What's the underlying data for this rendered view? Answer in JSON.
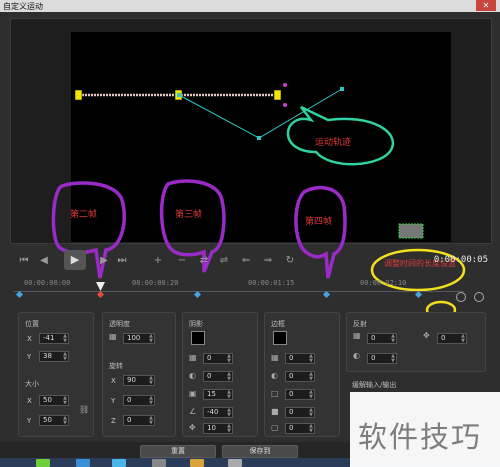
{
  "window": {
    "title": "自定义运动",
    "close_glyph": "✕"
  },
  "annotations": {
    "motion_path": "运动轨迹",
    "frame2": "第二帧",
    "frame3": "第三帧",
    "frame4": "第四帧",
    "timecode_note": "调整时间的长度设置"
  },
  "playback": {
    "timecode": "0:00:00:05"
  },
  "ruler": {
    "labels": [
      "00:00:00:00",
      "00:00:00:20",
      "00:00:01:15",
      "00:00:02:10"
    ]
  },
  "position": {
    "label": "位置",
    "x_label": "X",
    "x": "-41",
    "y_label": "Y",
    "y": "38"
  },
  "size": {
    "label": "大小",
    "x_label": "X",
    "x": "50",
    "y_label": "Y",
    "y": "50"
  },
  "opacity": {
    "label": "透明度",
    "value": "100"
  },
  "rotation": {
    "label": "旋转",
    "x_label": "X",
    "x": "90",
    "y_label": "Y",
    "y": "0",
    "z_label": "Z",
    "z": "0"
  },
  "shadow": {
    "label": "阴影",
    "v1": "0",
    "v2": "0",
    "v3": "15",
    "v4": "-40",
    "v5": "10"
  },
  "border": {
    "label": "边框",
    "v1": "0",
    "v2": "0",
    "v3": "0",
    "v4": "0",
    "v5": "0"
  },
  "reflection": {
    "label": "反射",
    "v1": "0",
    "v2": "0",
    "v3": "0"
  },
  "ease": {
    "label": "缓解输入/输出"
  },
  "buttons": {
    "reset": "重置",
    "save_to": "保存到"
  },
  "watermark": "软件技巧",
  "colors": {
    "accent_keyframe": "#46a3e0",
    "annotation_red": "#e23a3a",
    "bubble_purple": "#9a2bc8",
    "bubble_green": "#2fd2a0",
    "bubble_yellow": "#f2e01f"
  }
}
